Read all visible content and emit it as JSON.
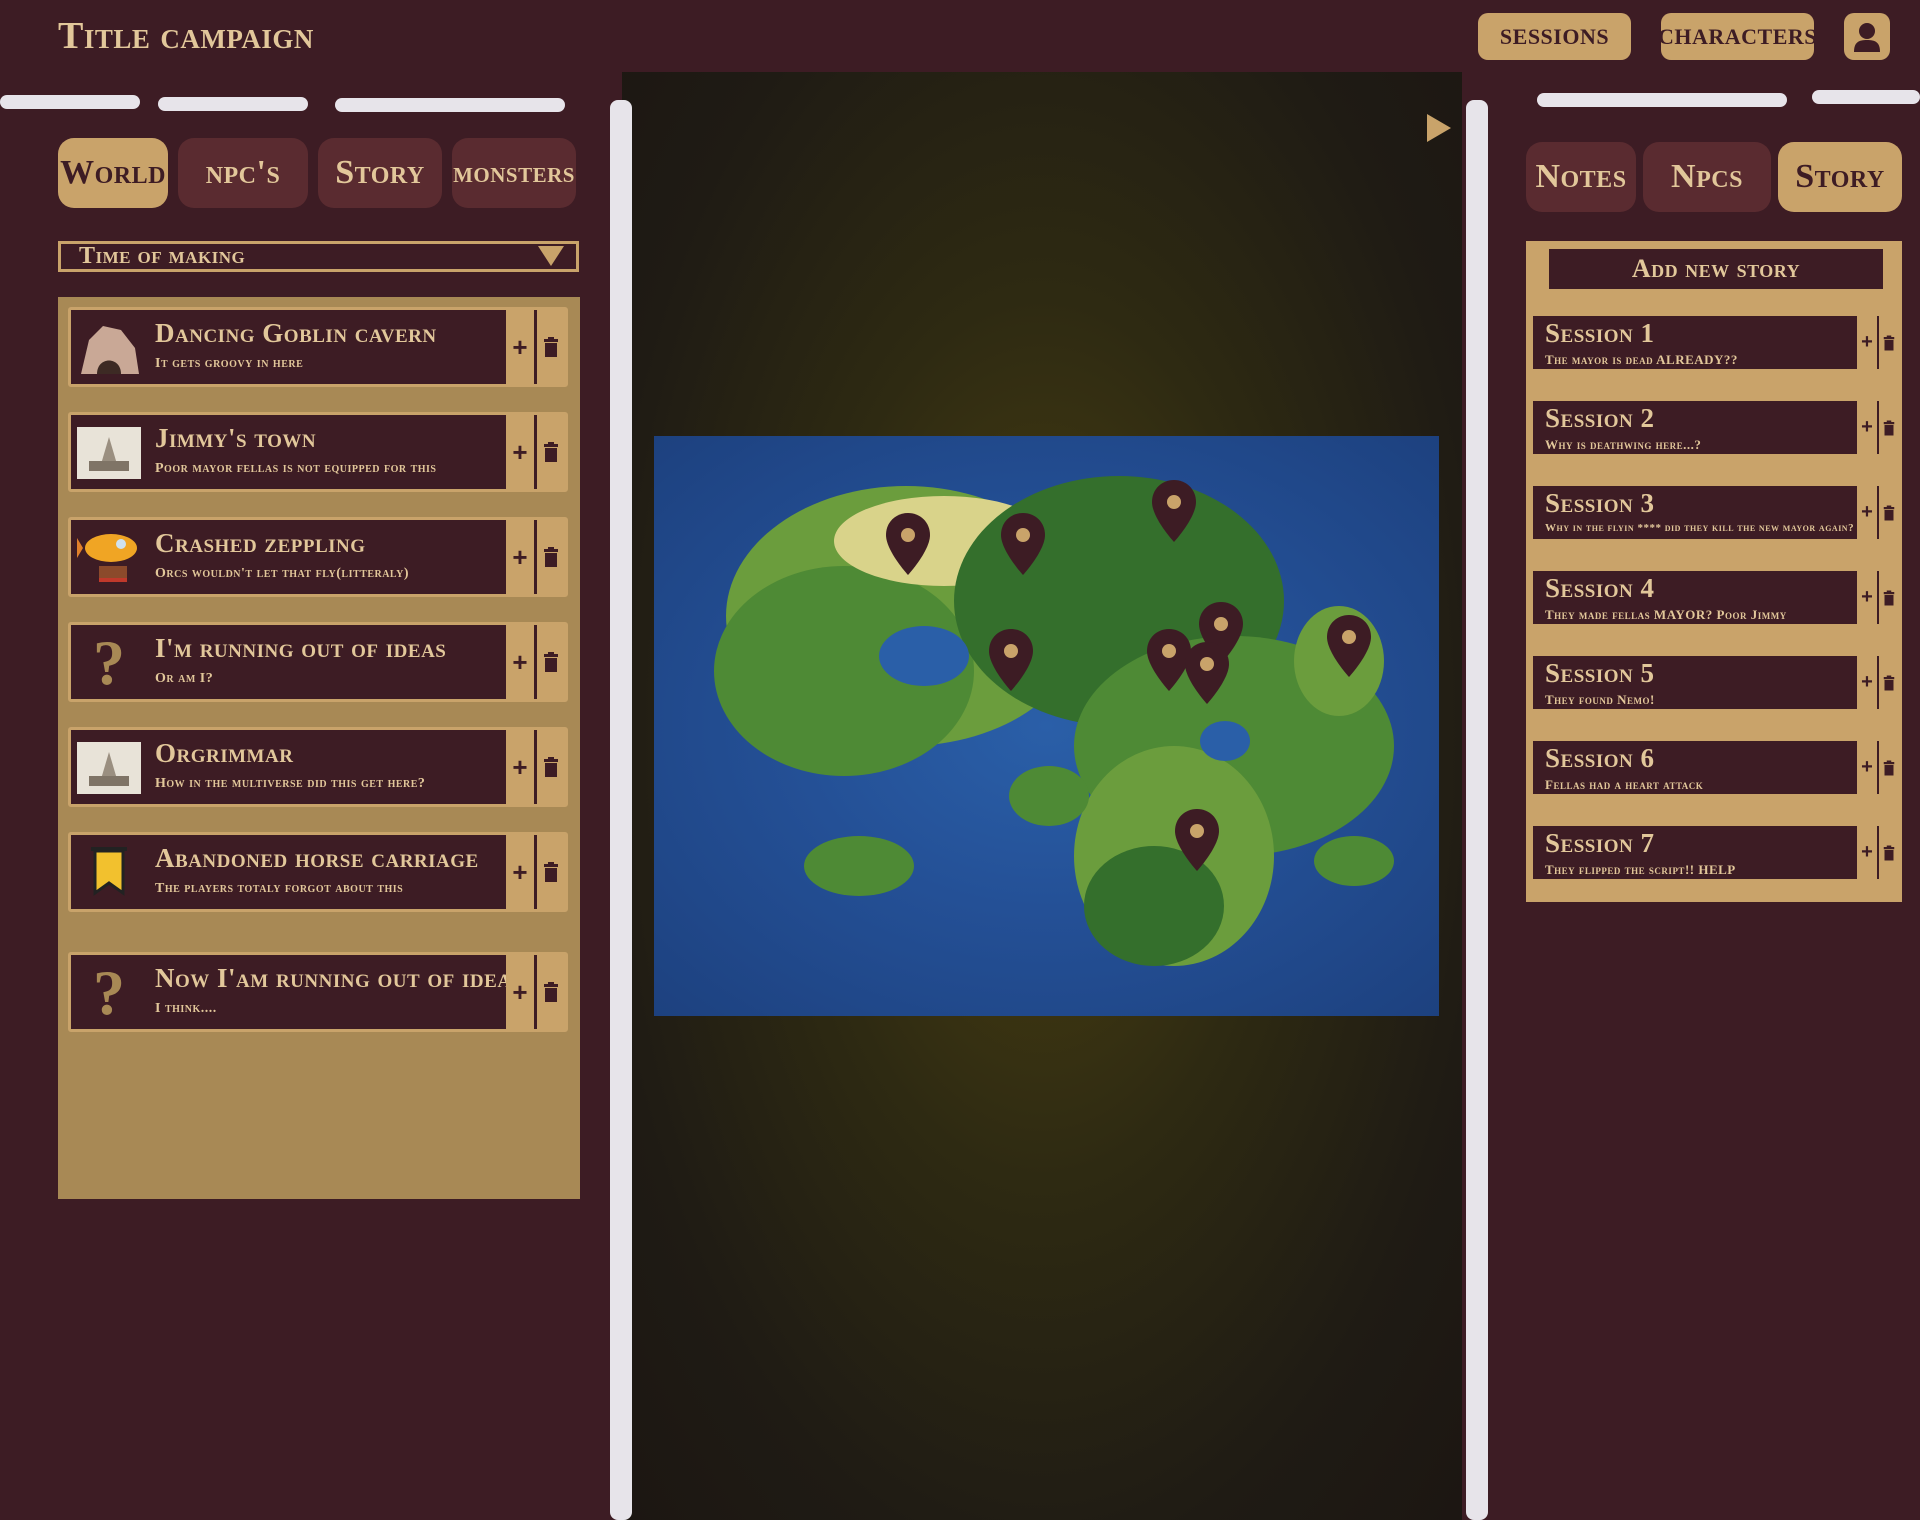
{
  "header": {
    "title": "Title campaign",
    "nav": {
      "sessions": "SESSIONS",
      "characters": "CHARACTERS"
    }
  },
  "left_panel": {
    "tabs": [
      "World",
      "npc's",
      "Story",
      "monsters"
    ],
    "active_tab": "World",
    "filter": {
      "value": "Time of making"
    },
    "items": [
      {
        "title": "Dancing Goblin cavern",
        "subtitle": "It gets groovy in here",
        "icon": "cave-icon"
      },
      {
        "title": "Jimmy's town",
        "subtitle": "Poor mayor fellas is not equipped for this",
        "icon": "town-icon"
      },
      {
        "title": "Crashed zeppling",
        "subtitle": "Orcs wouldn't let that fly(litteraly)",
        "icon": "zeppelin-icon"
      },
      {
        "title": "I'm running out of ideas",
        "subtitle": "Or am I?",
        "icon": "question-icon"
      },
      {
        "title": "Orgrimmar",
        "subtitle": "How in the multiverse did this get here?",
        "icon": "town-icon"
      },
      {
        "title": "Abandoned horse carriage",
        "subtitle": "The players totaly forgot about this",
        "icon": "banner-icon"
      },
      {
        "title": "Now I'am running out of ideas",
        "subtitle": "I think....",
        "icon": "question-icon"
      }
    ],
    "add_symbol": "+"
  },
  "right_panel": {
    "tabs": [
      "Notes",
      "Npcs",
      "Story"
    ],
    "active_tab": "Story",
    "add_story_label": "Add new story",
    "sessions": [
      {
        "title": "Session 1",
        "subtitle": "The mayor is dead ALREADY??"
      },
      {
        "title": "Session 2",
        "subtitle": "Why is deathwing here...?"
      },
      {
        "title": "Session 3",
        "subtitle": "Why in the flyin **** did they kill the new mayor again?"
      },
      {
        "title": "Session 4",
        "subtitle": "They made fellas MAYOR? Poor Jimmy"
      },
      {
        "title": "Session 5",
        "subtitle": "They found Nemo!"
      },
      {
        "title": "Session 6",
        "subtitle": "Fellas had a heart attack"
      },
      {
        "title": "Session 7",
        "subtitle": "They flipped the script!! HELP"
      }
    ]
  },
  "map": {
    "pin_count": 10,
    "colors": {
      "pin": "#3d1c24",
      "pin_dot": "#c9a36a"
    }
  },
  "colors": {
    "background": "#3d1c24",
    "accent": "#c9a36a",
    "panel": "#a88955",
    "text": "#e2c79a"
  }
}
